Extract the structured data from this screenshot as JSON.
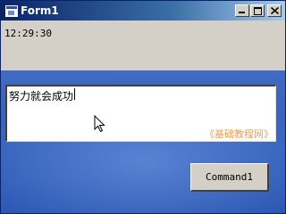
{
  "window": {
    "title": "Form1",
    "time": "12:29:30",
    "textbox_value": "努力就会成功",
    "watermark": "《基础教程网》",
    "command_label": "Command1"
  }
}
